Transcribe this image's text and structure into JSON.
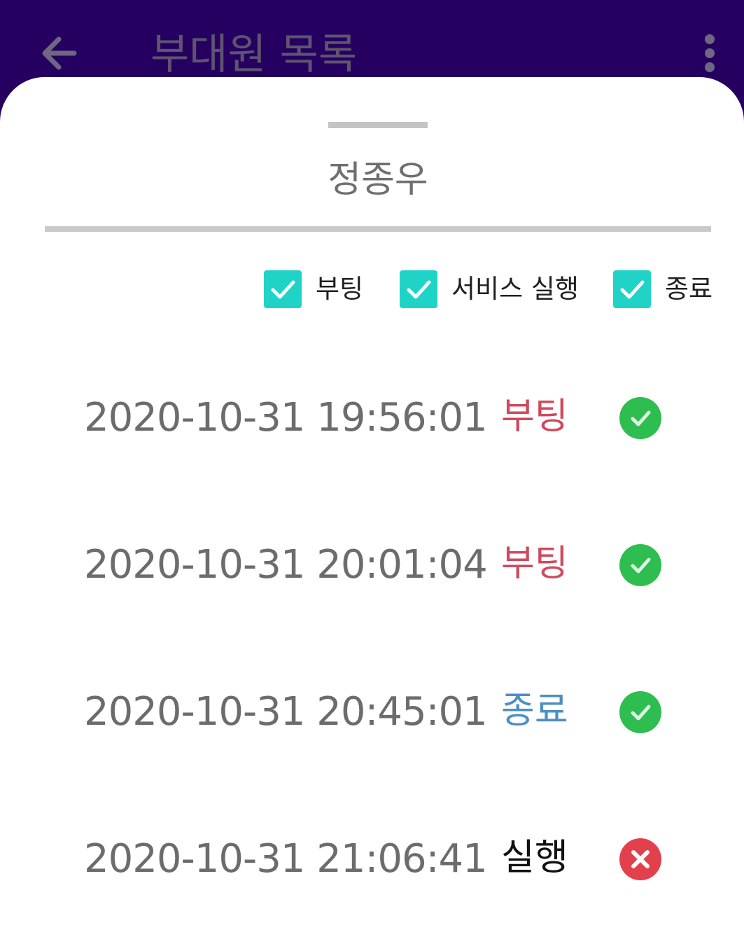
{
  "app_bar": {
    "title": "부대원 목록",
    "back_icon": "arrow-left-icon",
    "more_icon": "more-vertical-icon"
  },
  "sheet": {
    "title": "정종우",
    "filters": [
      {
        "label": "부팅",
        "checked": true
      },
      {
        "label": "서비스 실행",
        "checked": true
      },
      {
        "label": "종료",
        "checked": true
      }
    ],
    "rows": [
      {
        "time": "2020-10-31 19:56:01",
        "event": "부팅",
        "event_color": "#cf4a5e",
        "status": "success"
      },
      {
        "time": "2020-10-31 20:01:04",
        "event": "부팅",
        "event_color": "#cf4a5e",
        "status": "success"
      },
      {
        "time": "2020-10-31 20:45:01",
        "event": "종료",
        "event_color": "#4a8fc6",
        "status": "success"
      },
      {
        "time": "2020-10-31 21:06:41",
        "event": "실행",
        "event_color": "#111111",
        "status": "failure"
      }
    ]
  },
  "colors": {
    "app_bar": "#250060",
    "checkbox": "#1fd3c7",
    "success": "#2ebd4f",
    "failure": "#e2404a"
  }
}
